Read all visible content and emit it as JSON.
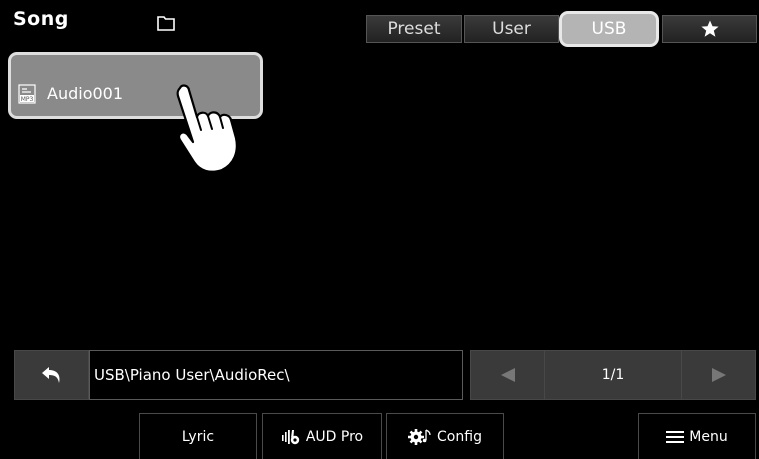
{
  "header": {
    "title": "Song",
    "tabs": [
      {
        "label": "Preset",
        "selected": false
      },
      {
        "label": "User",
        "selected": false
      },
      {
        "label": "USB",
        "selected": true
      },
      {
        "label": "",
        "icon": "star-icon",
        "selected": false
      }
    ]
  },
  "file_list": [
    {
      "label": "Audio001",
      "icon": "mp3-file-icon",
      "selected": true
    }
  ],
  "path_bar": {
    "path": "USB\\Piano User\\AudioRec\\",
    "page": "1/1"
  },
  "bottom_bar": {
    "lyric": "Lyric",
    "aud_pro": "AUD Pro",
    "config": "Config",
    "menu": "Menu"
  },
  "colors": {
    "background": "#000000",
    "selected_item": "#8a8a8a",
    "selected_tab": "#b4b4b4",
    "button": "#3a3a3a"
  }
}
